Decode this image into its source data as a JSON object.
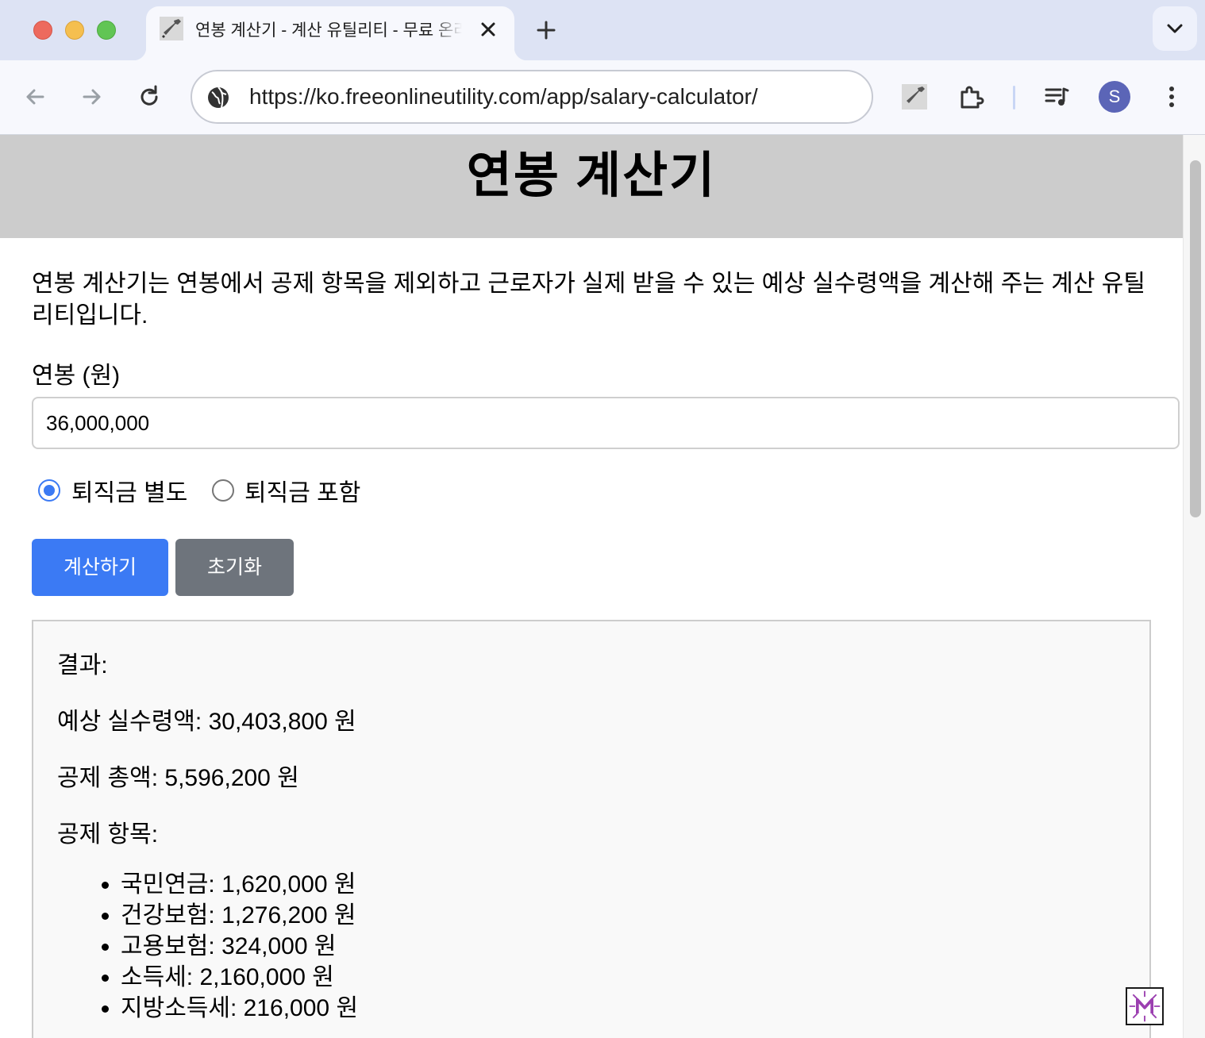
{
  "browser": {
    "tab_title": "연봉 계산기 - 계산 유틸리티 - 무료 온라인 유틸리티",
    "url": "https://ko.freeonlineutility.com/app/salary-calculator/",
    "profile_initial": "S"
  },
  "page": {
    "title": "연봉 계산기",
    "intro": "연봉 계산기는 연봉에서 공제 항목을 제외하고 근로자가 실제 받을 수 있는 예상 실수령액을 계산해 주는 계산 유틸리티입니다.",
    "salary_label": "연봉 (원)",
    "salary_value": "36,000,000",
    "radio_options": [
      {
        "label": "퇴직금 별도",
        "checked": true
      },
      {
        "label": "퇴직금 포함",
        "checked": false
      }
    ],
    "calculate_button": "계산하기",
    "reset_button": "초기화"
  },
  "result": {
    "heading": "결과:",
    "net_pay": "예상 실수령액: 30,403,800 원",
    "total_deduction": "공제 총액: 5,596,200 원",
    "deductions_heading": "공제 항목:",
    "deductions": [
      "국민연금: 1,620,000 원",
      "건강보험: 1,276,200 원",
      "고용보험: 324,000 원",
      "소득세: 2,160,000 원",
      "지방소득세: 216,000 원"
    ]
  },
  "colors": {
    "primary": "#3b7af4",
    "secondary": "#6e747c",
    "header_bg": "#cccccc"
  }
}
